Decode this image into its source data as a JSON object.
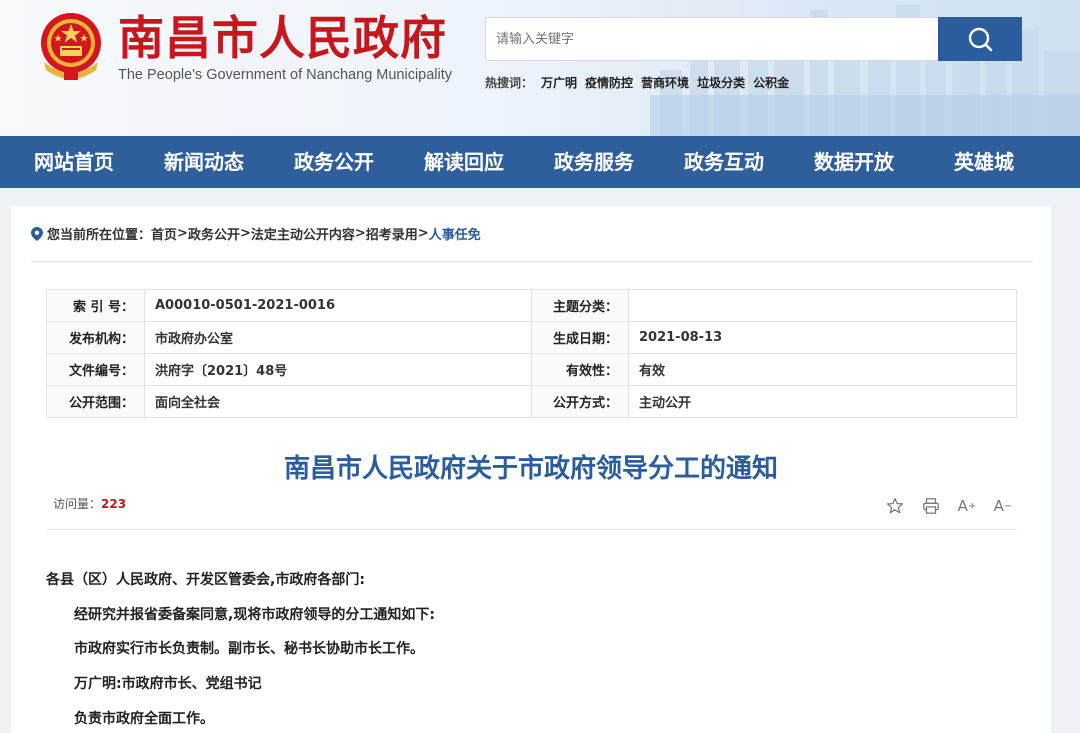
{
  "header": {
    "title": "南昌市人民政府",
    "subtitle": "The People's Government of Nanchang Municipality",
    "search": {
      "placeholder": "请输入关键字"
    },
    "hot_label": "热搜词：",
    "hot_words": [
      "万广明",
      "疫情防控",
      "营商环境",
      "垃圾分类",
      "公积金"
    ]
  },
  "nav": {
    "items": [
      "网站首页",
      "新闻动态",
      "政务公开",
      "解读回应",
      "政务服务",
      "政务互动",
      "数据开放",
      "英雄城"
    ]
  },
  "breadcrumb": {
    "prefix": "您当前所在位置：",
    "items": [
      "首页",
      "政务公开",
      "法定主动公开内容",
      "招考录用"
    ],
    "current": "人事任免",
    "sep": ">"
  },
  "meta": {
    "rows": [
      {
        "l1": "索 引 号：",
        "v1": "A00010-0501-2021-0016",
        "l2": "主题分类：",
        "v2": ""
      },
      {
        "l1": "发布机构：",
        "v1": "市政府办公室",
        "l2": "生成日期：",
        "v2": "2021-08-13"
      },
      {
        "l1": "文件编号：",
        "v1": "洪府字〔2021〕48号",
        "l2": "有效性：",
        "v2": "有效"
      },
      {
        "l1": "公开范围：",
        "v1": "面向全社会",
        "l2": "公开方式：",
        "v2": "主动公开"
      }
    ]
  },
  "article": {
    "title": "南昌市人民政府关于市政府领导分工的通知",
    "views_label": "访问量：",
    "views_count": "223",
    "tools": {
      "zoom_in": "A",
      "zoom_out": "A"
    },
    "paragraphs": [
      "各县（区）人民政府、开发区管委会,市政府各部门:",
      "经研究并报省委备案同意,现将市政府领导的分工通知如下:",
      "市政府实行市长负责制。副市长、秘书长协助市长工作。",
      "万广明:市政府市长、党组书记",
      "负责市政府全面工作。"
    ]
  },
  "colors": {
    "brand_red": "#c8161d",
    "nav_blue": "#2f5f9b",
    "title_blue": "#2b5c9c",
    "count_red": "#b0211e"
  }
}
